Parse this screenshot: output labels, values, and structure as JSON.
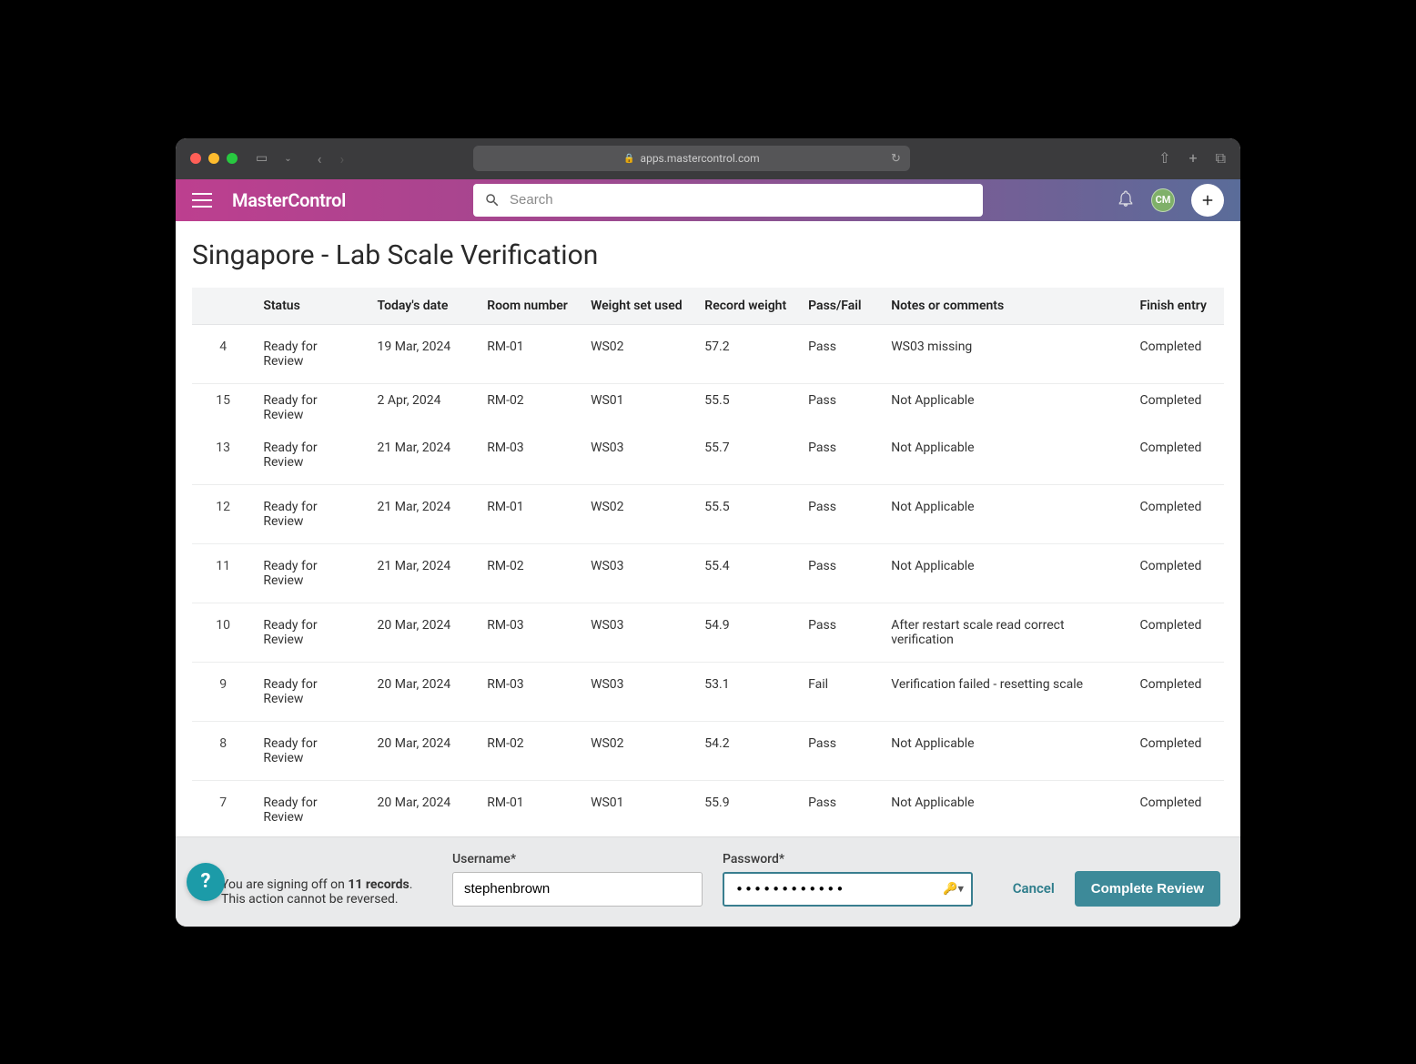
{
  "browser": {
    "url": "apps.mastercontrol.com"
  },
  "header": {
    "logo": "MasterControl",
    "search_placeholder": "Search",
    "avatar_initials": "CM"
  },
  "page": {
    "title": "Singapore - Lab Scale Verification"
  },
  "table": {
    "headers": {
      "status": "Status",
      "date": "Today's date",
      "room": "Room number",
      "ws": "Weight set used",
      "rw": "Record weight",
      "pf": "Pass/Fail",
      "notes": "Notes or comments",
      "finish": "Finish entry"
    },
    "rows": [
      {
        "idx": "4",
        "status": "Ready for Review",
        "date": "19 Mar, 2024",
        "room": "RM-01",
        "ws": "WS02",
        "rw": "57.2",
        "pf": "Pass",
        "notes": "WS03 missing",
        "finish": "Completed"
      },
      {
        "idx": "15",
        "status": "Ready for Review",
        "date": "2 Apr, 2024",
        "room": "RM-02",
        "ws": "WS01",
        "rw": "55.5",
        "pf": "Pass",
        "notes": "Not Applicable",
        "finish": "Completed"
      },
      {
        "idx": "13",
        "status": "Ready for Review",
        "date": "21 Mar, 2024",
        "room": "RM-03",
        "ws": "WS03",
        "rw": "55.7",
        "pf": "Pass",
        "notes": "Not Applicable",
        "finish": "Completed"
      },
      {
        "idx": "12",
        "status": "Ready for Review",
        "date": "21 Mar, 2024",
        "room": "RM-01",
        "ws": "WS02",
        "rw": "55.5",
        "pf": "Pass",
        "notes": "Not Applicable",
        "finish": "Completed"
      },
      {
        "idx": "11",
        "status": "Ready for Review",
        "date": "21 Mar, 2024",
        "room": "RM-02",
        "ws": "WS03",
        "rw": "55.4",
        "pf": "Pass",
        "notes": "Not Applicable",
        "finish": "Completed"
      },
      {
        "idx": "10",
        "status": "Ready for Review",
        "date": "20 Mar, 2024",
        "room": "RM-03",
        "ws": "WS03",
        "rw": "54.9",
        "pf": "Pass",
        "notes": "After restart scale read correct verification",
        "finish": "Completed"
      },
      {
        "idx": "9",
        "status": "Ready for Review",
        "date": "20 Mar, 2024",
        "room": "RM-03",
        "ws": "WS03",
        "rw": "53.1",
        "pf": "Fail",
        "notes": "Verification failed - resetting scale",
        "finish": "Completed"
      },
      {
        "idx": "8",
        "status": "Ready for Review",
        "date": "20 Mar, 2024",
        "room": "RM-02",
        "ws": "WS02",
        "rw": "54.2",
        "pf": "Pass",
        "notes": "Not Applicable",
        "finish": "Completed"
      },
      {
        "idx": "7",
        "status": "Ready for Review",
        "date": "20 Mar, 2024",
        "room": "RM-01",
        "ws": "WS01",
        "rw": "55.9",
        "pf": "Pass",
        "notes": "Not Applicable",
        "finish": "Completed"
      }
    ]
  },
  "signoff": {
    "message_prefix": "You are signing off on ",
    "record_count": "11 records",
    "message_suffix": ". This action cannot be reversed.",
    "username_label": "Username*",
    "username_value": "stephenbrown",
    "password_label": "Password*",
    "password_value": "••••••••••••",
    "cancel_label": "Cancel",
    "complete_label": "Complete Review"
  },
  "help_fab": "?"
}
